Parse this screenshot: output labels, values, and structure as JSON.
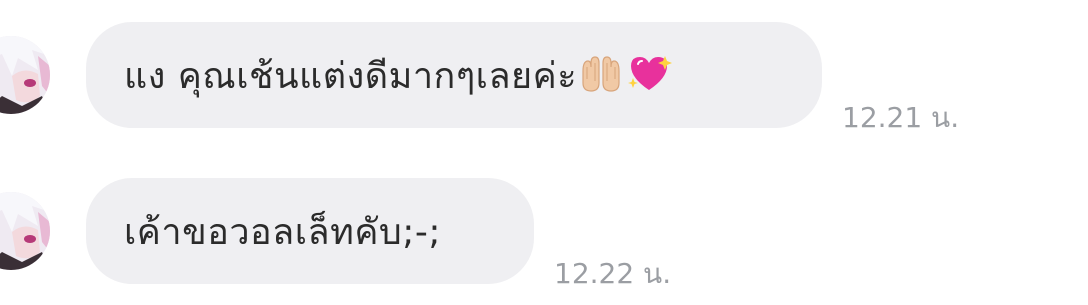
{
  "messages": [
    {
      "text": "แง คุณเช้นแต่งดีมากๆเลยค่ะ",
      "emojis": [
        "palms-up-together-emoji",
        "sparkling-heart-emoji"
      ],
      "time": "12.21 น."
    },
    {
      "text": "เค้าขอวอลเล็ทคับ;-;",
      "emojis": [],
      "time": "12.22 น."
    }
  ],
  "colors": {
    "bubble": "#efeff2",
    "text": "#2b2b2b",
    "time": "#9b9ea3",
    "background": "#ffffff"
  }
}
